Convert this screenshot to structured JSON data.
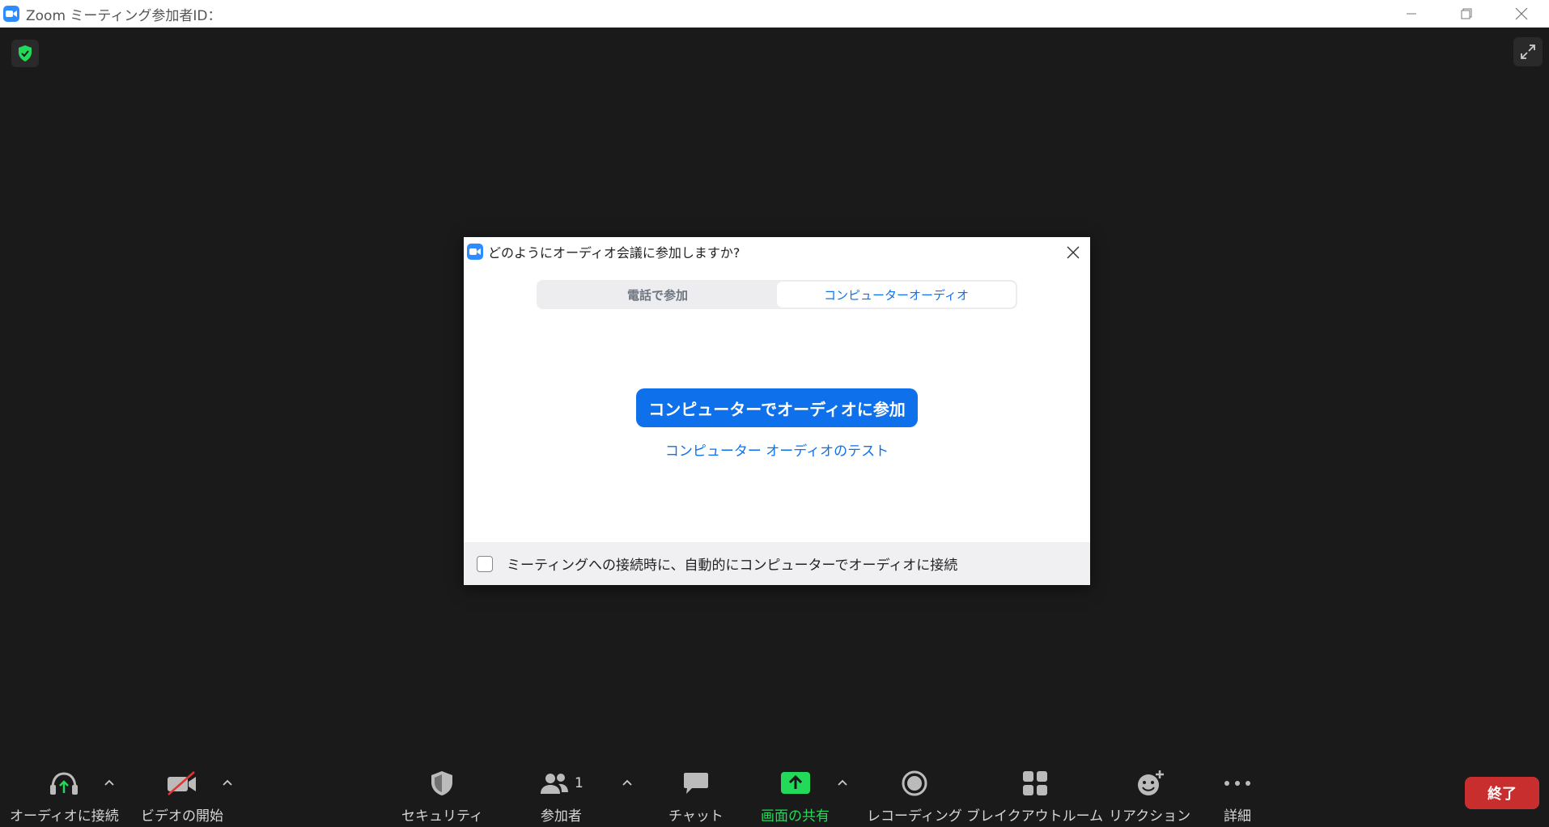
{
  "window": {
    "title": "Zoom ミーティング参加者ID："
  },
  "dialog": {
    "title": "どのようにオーディオ会議に参加しますか?",
    "tabs": [
      {
        "label": "電話で参加",
        "active": false
      },
      {
        "label": "コンピューターオーディオ",
        "active": true
      }
    ],
    "join_button": "コンピューターでオーディオに参加",
    "test_link": "コンピューター オーディオのテスト",
    "auto_connect_label": "ミーティングへの接続時に、自動的にコンピューターでオーディオに接続",
    "auto_connect_checked": false
  },
  "toolbar": {
    "audio": "オーディオに接続",
    "video": "ビデオの開始",
    "security": "セキュリティ",
    "participants": "参加者",
    "participants_count": "1",
    "chat": "チャット",
    "share": "画面の共有",
    "record": "レコーディング",
    "breakout": "ブレイクアウトルーム",
    "reactions": "リアクション",
    "more": "詳細",
    "end": "終了"
  },
  "colors": {
    "accent": "#0e71eb",
    "share_green": "#23d959",
    "end_red": "#c82e2e",
    "background": "#1a1a1a"
  }
}
